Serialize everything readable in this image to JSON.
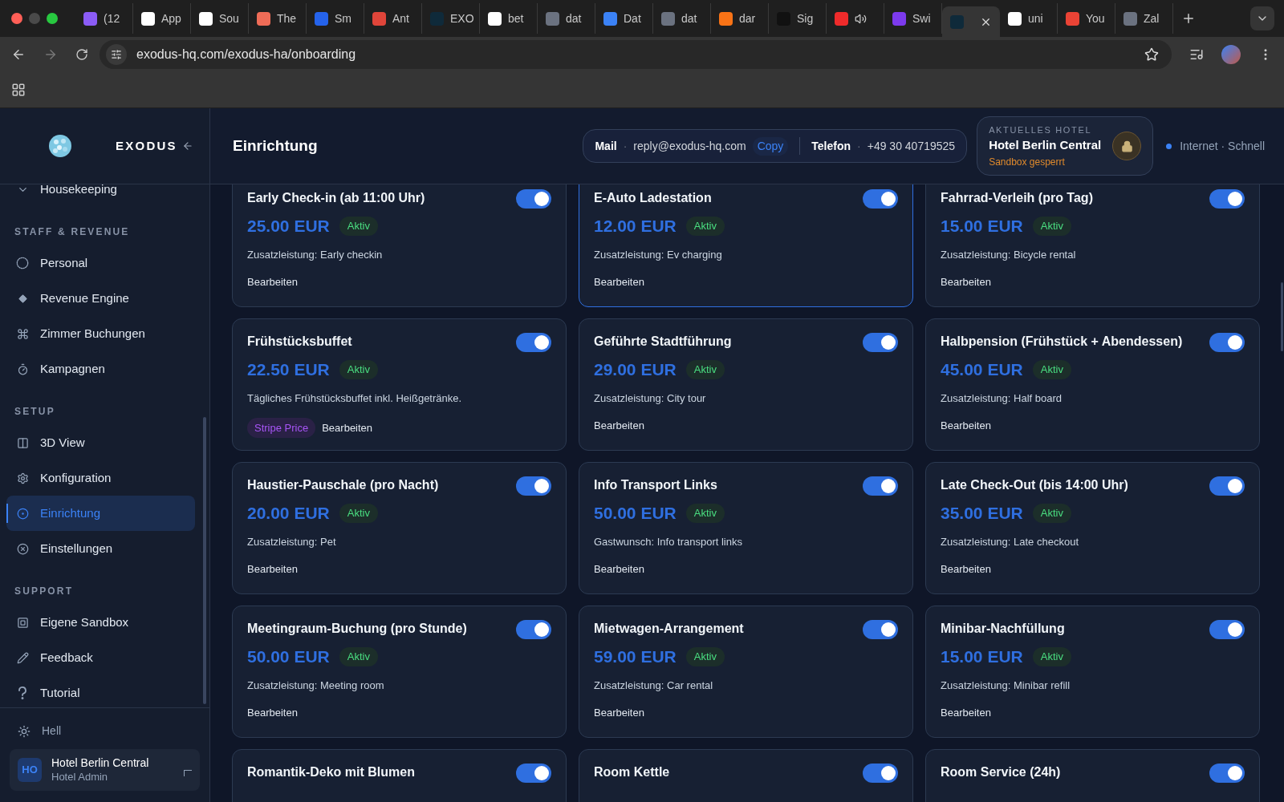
{
  "browser": {
    "tabs": [
      {
        "label": "(12",
        "selected": false
      },
      {
        "label": "App",
        "selected": false
      },
      {
        "label": "Sou",
        "selected": false
      },
      {
        "label": "The",
        "selected": false
      },
      {
        "label": "Sm",
        "selected": false
      },
      {
        "label": "Ant",
        "selected": false
      },
      {
        "label": "EXO",
        "selected": false
      },
      {
        "label": "bet",
        "selected": false
      },
      {
        "label": "dat",
        "selected": false
      },
      {
        "label": "Dat",
        "selected": false
      },
      {
        "label": "dat",
        "selected": false
      },
      {
        "label": "dar",
        "selected": false
      },
      {
        "label": "Sig",
        "selected": false
      },
      {
        "selected": false
      },
      {
        "label": "Swi",
        "selected": false
      },
      {
        "selected": true
      },
      {
        "label": "uni",
        "selected": false
      },
      {
        "label": "You",
        "selected": false
      },
      {
        "label": "Zal",
        "selected": false
      }
    ],
    "url": "exodus-hq.com/exodus-ha/onboarding"
  },
  "sidebar": {
    "brand": "EXODUS",
    "sections": [
      {
        "items": [
          {
            "label": "Housekeeping",
            "selected": false
          }
        ]
      },
      {
        "title": "STAFF & REVENUE",
        "items": [
          {
            "label": "Personal",
            "selected": false
          },
          {
            "label": "Revenue Engine",
            "selected": false
          },
          {
            "label": "Zimmer Buchungen",
            "selected": false
          },
          {
            "label": "Kampagnen",
            "selected": false
          }
        ]
      },
      {
        "title": "SETUP",
        "items": [
          {
            "label": "3D View",
            "selected": false
          },
          {
            "label": "Konfiguration",
            "selected": false
          },
          {
            "label": "Einrichtung",
            "selected": true
          },
          {
            "label": "Einstellungen",
            "selected": false
          }
        ]
      },
      {
        "title": "SUPPORT",
        "items": [
          {
            "label": "Eigene Sandbox",
            "selected": false
          },
          {
            "label": "Feedback",
            "selected": false
          },
          {
            "label": "Tutorial",
            "selected": false
          }
        ]
      }
    ],
    "theme": "Hell",
    "user": {
      "initials": "HO",
      "name": "Hotel Berlin Central",
      "role": "Hotel Admin"
    }
  },
  "header": {
    "title": "Einrichtung",
    "contact": {
      "mail_label": "Mail",
      "separator": "·",
      "mail": "reply@exodus-hq.com",
      "copy": "Copy",
      "phone_label": "Telefon",
      "phone": "+49 30 40719525"
    },
    "hotel": {
      "caption": "AKTUELLES HOTEL",
      "name": "Hotel Berlin Central",
      "status": "Sandbox gesperrt"
    },
    "connection": "Internet · Schnell"
  },
  "cards": [
    {
      "title": "Early Check-in (ab 11:00 Uhr)",
      "price": "25.00 EUR",
      "status": "Aktiv",
      "description": "Zusatzleistung: Early checkin",
      "action": "Bearbeiten",
      "on": true,
      "selected": false
    },
    {
      "title": "E-Auto Ladestation",
      "price": "12.00 EUR",
      "status": "Aktiv",
      "description": "Zusatzleistung: Ev charging",
      "action": "Bearbeiten",
      "on": true,
      "selected": true
    },
    {
      "title": "Fahrrad-Verleih (pro Tag)",
      "price": "15.00 EUR",
      "status": "Aktiv",
      "description": "Zusatzleistung: Bicycle rental",
      "action": "Bearbeiten",
      "on": true,
      "selected": false
    },
    {
      "title": "Frühstücksbuffet",
      "price": "22.50 EUR",
      "status": "Aktiv",
      "description": "Tägliches Frühstücksbuffet inkl. Heißgetränke.",
      "badge": "Stripe Price",
      "action": "Bearbeiten",
      "on": true,
      "selected": false
    },
    {
      "title": "Geführte Stadtführung",
      "price": "29.00 EUR",
      "status": "Aktiv",
      "description": "Zusatzleistung: City tour",
      "action": "Bearbeiten",
      "on": true,
      "selected": false
    },
    {
      "title": "Halbpension (Frühstück + Abendessen)",
      "price": "45.00 EUR",
      "status": "Aktiv",
      "description": "Zusatzleistung: Half board",
      "action": "Bearbeiten",
      "on": true,
      "selected": false
    },
    {
      "title": "Haustier-Pauschale (pro Nacht)",
      "price": "20.00 EUR",
      "status": "Aktiv",
      "description": "Zusatzleistung: Pet",
      "action": "Bearbeiten",
      "on": true,
      "selected": false
    },
    {
      "title": "Info Transport Links",
      "price": "50.00 EUR",
      "status": "Aktiv",
      "description": "Gastwunsch: Info transport links",
      "action": "Bearbeiten",
      "on": true,
      "selected": false
    },
    {
      "title": "Late Check-Out (bis 14:00 Uhr)",
      "price": "35.00 EUR",
      "status": "Aktiv",
      "description": "Zusatzleistung: Late checkout",
      "action": "Bearbeiten",
      "on": true,
      "selected": false
    },
    {
      "title": "Meetingraum-Buchung (pro Stunde)",
      "price": "50.00 EUR",
      "status": "Aktiv",
      "description": "Zusatzleistung: Meeting room",
      "action": "Bearbeiten",
      "on": true,
      "selected": false
    },
    {
      "title": "Mietwagen-Arrangement",
      "price": "59.00 EUR",
      "status": "Aktiv",
      "description": "Zusatzleistung: Car rental",
      "action": "Bearbeiten",
      "on": true,
      "selected": false
    },
    {
      "title": "Minibar-Nachfüllung",
      "price": "15.00 EUR",
      "status": "Aktiv",
      "description": "Zusatzleistung: Minibar refill",
      "action": "Bearbeiten",
      "on": true,
      "selected": false
    },
    {
      "title": "Romantik-Deko mit Blumen",
      "on": true,
      "selected": false
    },
    {
      "title": "Room Kettle",
      "on": true,
      "selected": false
    },
    {
      "title": "Room Service (24h)",
      "on": true,
      "selected": false
    }
  ]
}
